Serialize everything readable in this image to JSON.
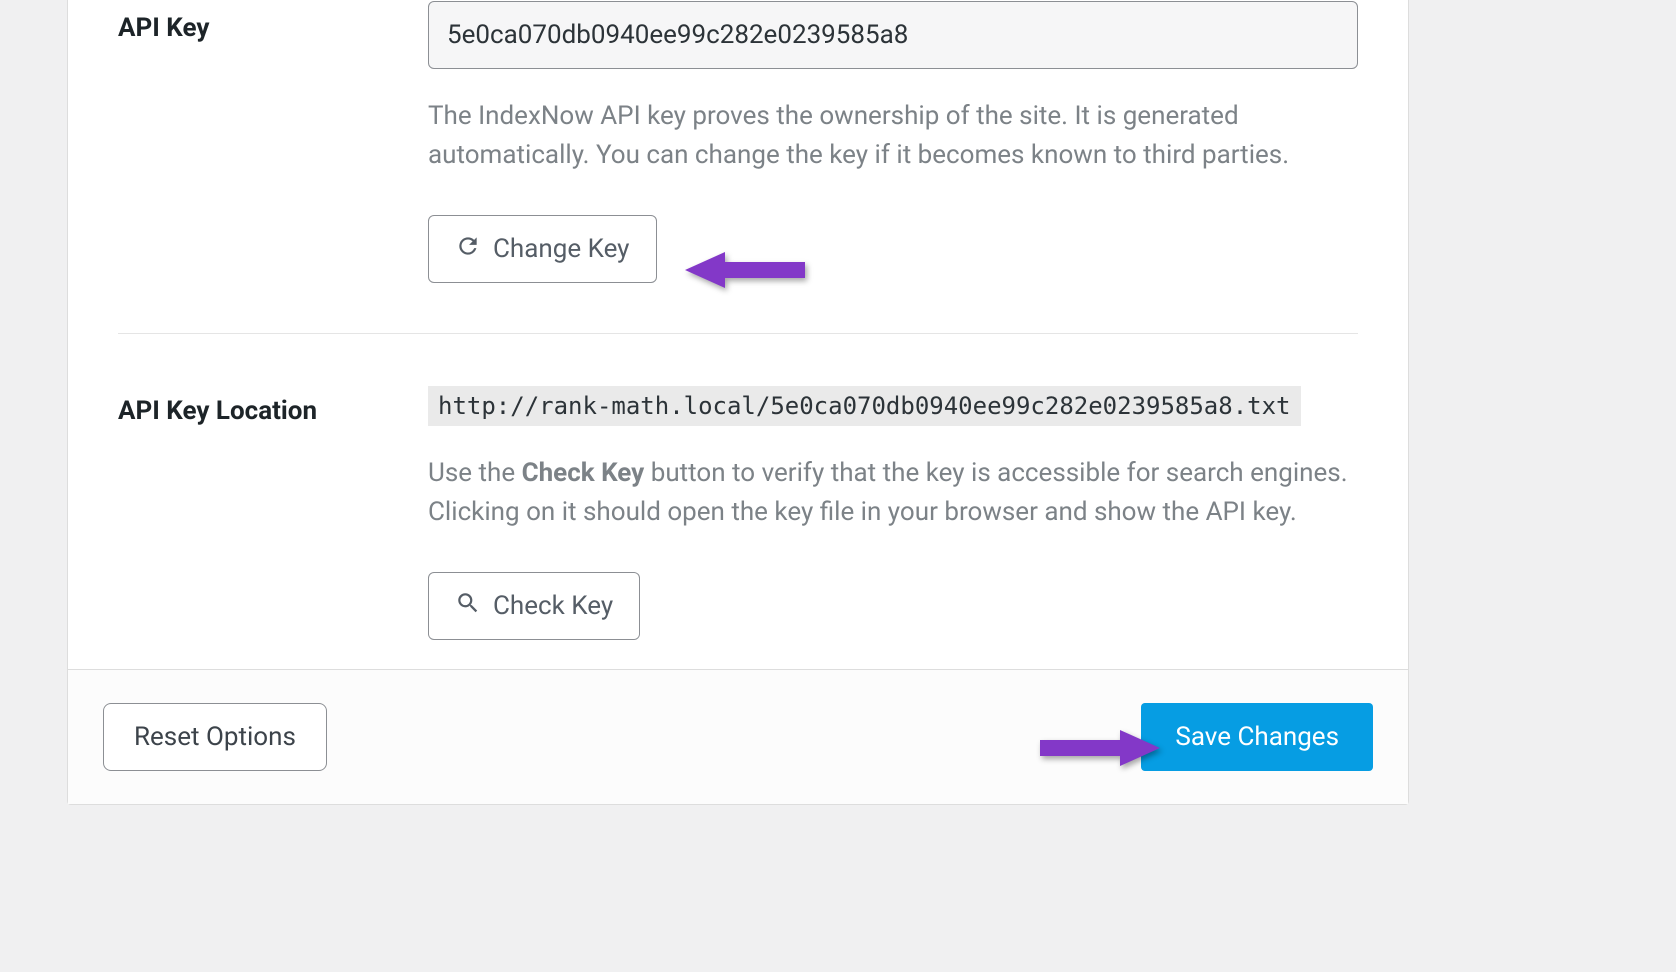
{
  "apiKey": {
    "label": "API Key",
    "value": "5e0ca070db0940ee99c282e0239585a8",
    "help": "The IndexNow API key proves the ownership of the site. It is generated automatically. You can change the key if it becomes known to third parties.",
    "changeKeyLabel": "Change Key"
  },
  "apiKeyLocation": {
    "label": "API Key Location",
    "url": "http://rank-math.local/5e0ca070db0940ee99c282e0239585a8.txt",
    "help_pre": "Use the ",
    "help_bold": "Check Key",
    "help_post": " button to verify that the key is accessible for search engines. Clicking on it should open the key file in your browser and show the API key.",
    "checkKeyLabel": "Check Key"
  },
  "footer": {
    "resetLabel": "Reset Options",
    "saveLabel": "Save Changes"
  }
}
